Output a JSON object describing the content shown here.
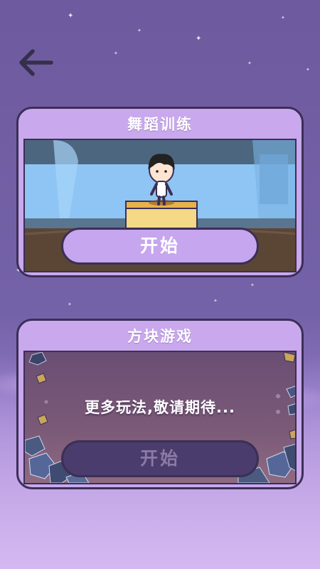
{
  "navigation": {
    "back_icon": "arrow-left-icon"
  },
  "cards": [
    {
      "title": "舞蹈训练",
      "button_label": "开始",
      "button_enabled": true
    },
    {
      "title": "方块游戏",
      "message": "更多玩法,敬请期待...",
      "button_label": "开始",
      "button_enabled": false
    }
  ],
  "colors": {
    "background_top": "#6e5a9e",
    "background_bottom": "#d4b8f0",
    "card": "#c9a8ee",
    "outline": "#3b2f55",
    "button_active": "#c6a6ee",
    "button_disabled": "#4a3c6c"
  }
}
